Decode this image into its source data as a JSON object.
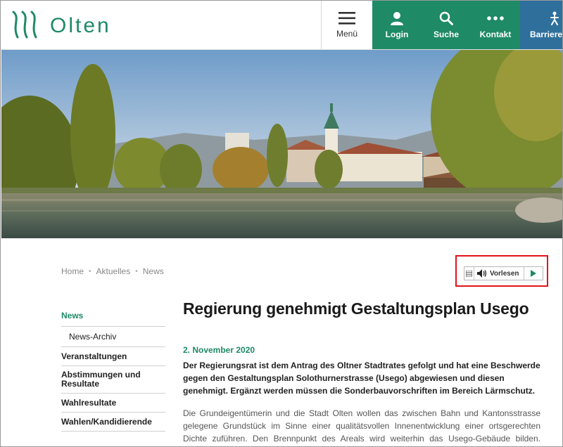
{
  "header": {
    "logo_text": "Olten",
    "nav": [
      {
        "label": "Menü",
        "icon": "menu-icon"
      },
      {
        "label": "Login",
        "icon": "user-icon"
      },
      {
        "label": "Suche",
        "icon": "search-icon"
      },
      {
        "label": "Kontakt",
        "icon": "more-dots-icon"
      },
      {
        "label": "Barrierefrei",
        "icon": "accessibility-icon"
      }
    ]
  },
  "breadcrumb": [
    "Home",
    "Aktuelles",
    "News"
  ],
  "readspeaker": {
    "label": "Vorlesen"
  },
  "sidebar": {
    "items": [
      {
        "label": "News",
        "active": true
      },
      {
        "label": "News-Archiv",
        "sub": true
      },
      {
        "label": "Veranstaltungen"
      },
      {
        "label": "Abstimmungen und Resultate"
      },
      {
        "label": "Wahlresultate"
      },
      {
        "label": "Wahlen/Kandidierende"
      }
    ]
  },
  "article": {
    "title": "Regierung genehmigt Gestaltungsplan Usego",
    "date": "2. November 2020",
    "lead": "Der Regierungsrat ist dem Antrag des Oltner Stadtrates gefolgt und hat eine Beschwerde gegen den Gestaltungsplan Solothurnerstrasse (Usego) abgewiesen und diesen genehmigt. Ergänzt werden müssen die Sonderbauvorschriften im Bereich Lärmschutz.",
    "body": "Die Grundeigentümerin und die Stadt Olten wollen das zwischen Bahn und Kantonsstrasse gelegene Grundstück im Sinne einer qualitätsvollen Innenentwicklung einer ortsgerechten Dichte zuführen. Den Brennpunkt des Areals wird weiterhin das Usego-Gebäude bilden. Nördlich davon"
  },
  "colors": {
    "brand_green": "#1e8a66",
    "accessibility_blue": "#2f6f9c",
    "highlight_red": "#e0141b"
  }
}
